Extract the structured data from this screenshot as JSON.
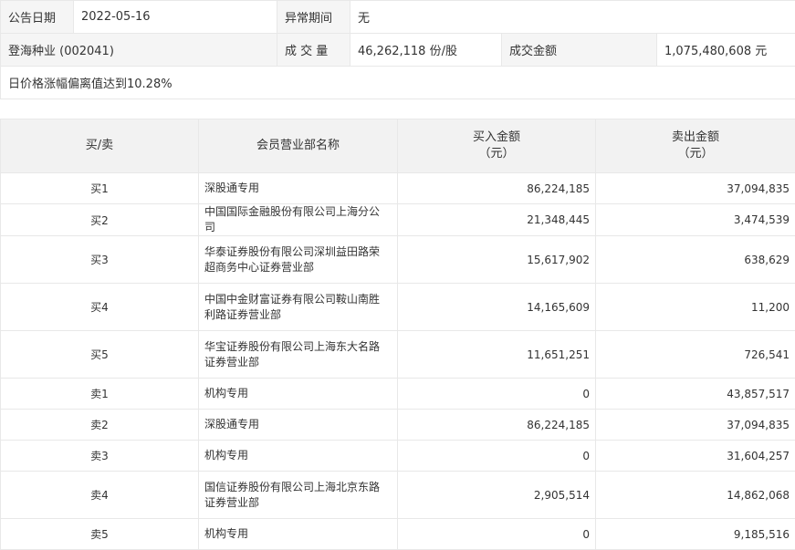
{
  "info": {
    "date_label": "公告日期",
    "date_value": "2022-05-16",
    "period_label": "异常期间",
    "period_value": "无",
    "stock_value": "登海种业 (002041)",
    "volume_label": "成 交 量",
    "volume_value": "46,262,118 份/股",
    "amount_label": "成交金额",
    "amount_value": "1,075,480,608 元",
    "reason": "日价格涨幅偏离值达到10.28%"
  },
  "table": {
    "headers": {
      "side": "买/卖",
      "dept": "会员营业部名称",
      "buy_line1": "买入金额",
      "buy_line2": "（元）",
      "sell_line1": "卖出金额",
      "sell_line2": "（元）"
    },
    "rows": [
      {
        "side": "买1",
        "dept": "深股通专用",
        "buy": "86,224,185",
        "sell": "37,094,835",
        "tall": false
      },
      {
        "side": "买2",
        "dept": "中国国际金融股份有限公司上海分公司",
        "buy": "21,348,445",
        "sell": "3,474,539",
        "tall": false
      },
      {
        "side": "买3",
        "dept": "华泰证券股份有限公司深圳益田路荣超商务中心证券营业部",
        "buy": "15,617,902",
        "sell": "638,629",
        "tall": true
      },
      {
        "side": "买4",
        "dept": "中国中金财富证券有限公司鞍山南胜利路证券营业部",
        "buy": "14,165,609",
        "sell": "11,200",
        "tall": true
      },
      {
        "side": "买5",
        "dept": "华宝证券股份有限公司上海东大名路证券营业部",
        "buy": "11,651,251",
        "sell": "726,541",
        "tall": true
      },
      {
        "side": "卖1",
        "dept": "机构专用",
        "buy": "0",
        "sell": "43,857,517",
        "tall": false
      },
      {
        "side": "卖2",
        "dept": "深股通专用",
        "buy": "86,224,185",
        "sell": "37,094,835",
        "tall": false
      },
      {
        "side": "卖3",
        "dept": "机构专用",
        "buy": "0",
        "sell": "31,604,257",
        "tall": false
      },
      {
        "side": "卖4",
        "dept": "国信证券股份有限公司上海北京东路证券营业部",
        "buy": "2,905,514",
        "sell": "14,862,068",
        "tall": true
      },
      {
        "side": "卖5",
        "dept": "机构专用",
        "buy": "0",
        "sell": "9,185,516",
        "tall": false
      }
    ]
  }
}
